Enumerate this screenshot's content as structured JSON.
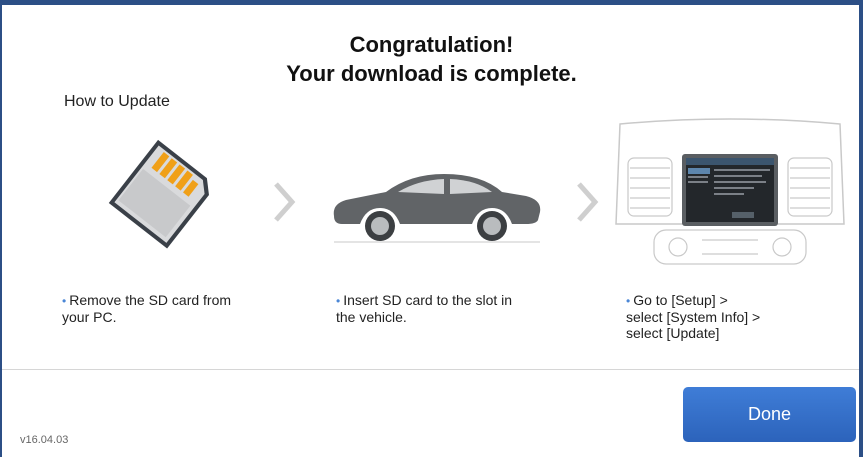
{
  "header": {
    "title_line1": "Congratulation!",
    "title_line2": "Your download is complete."
  },
  "how_to": {
    "label": "How to Update"
  },
  "steps": [
    {
      "illustration": "sd-card",
      "lines": [
        "Remove the SD card from",
        "your PC."
      ]
    },
    {
      "illustration": "car",
      "lines": [
        "Insert SD card to the slot in",
        "the vehicle."
      ]
    },
    {
      "illustration": "car-dashboard-screen",
      "lines": [
        "Go to [Setup] >",
        "select [System Info] >",
        "select [Update]"
      ]
    }
  ],
  "footer": {
    "version": "v16.04.03",
    "done_label": "Done"
  },
  "colors": {
    "accent": "#2c63bb",
    "bullet": "#4a86d6",
    "frame": "#2c4f86"
  }
}
